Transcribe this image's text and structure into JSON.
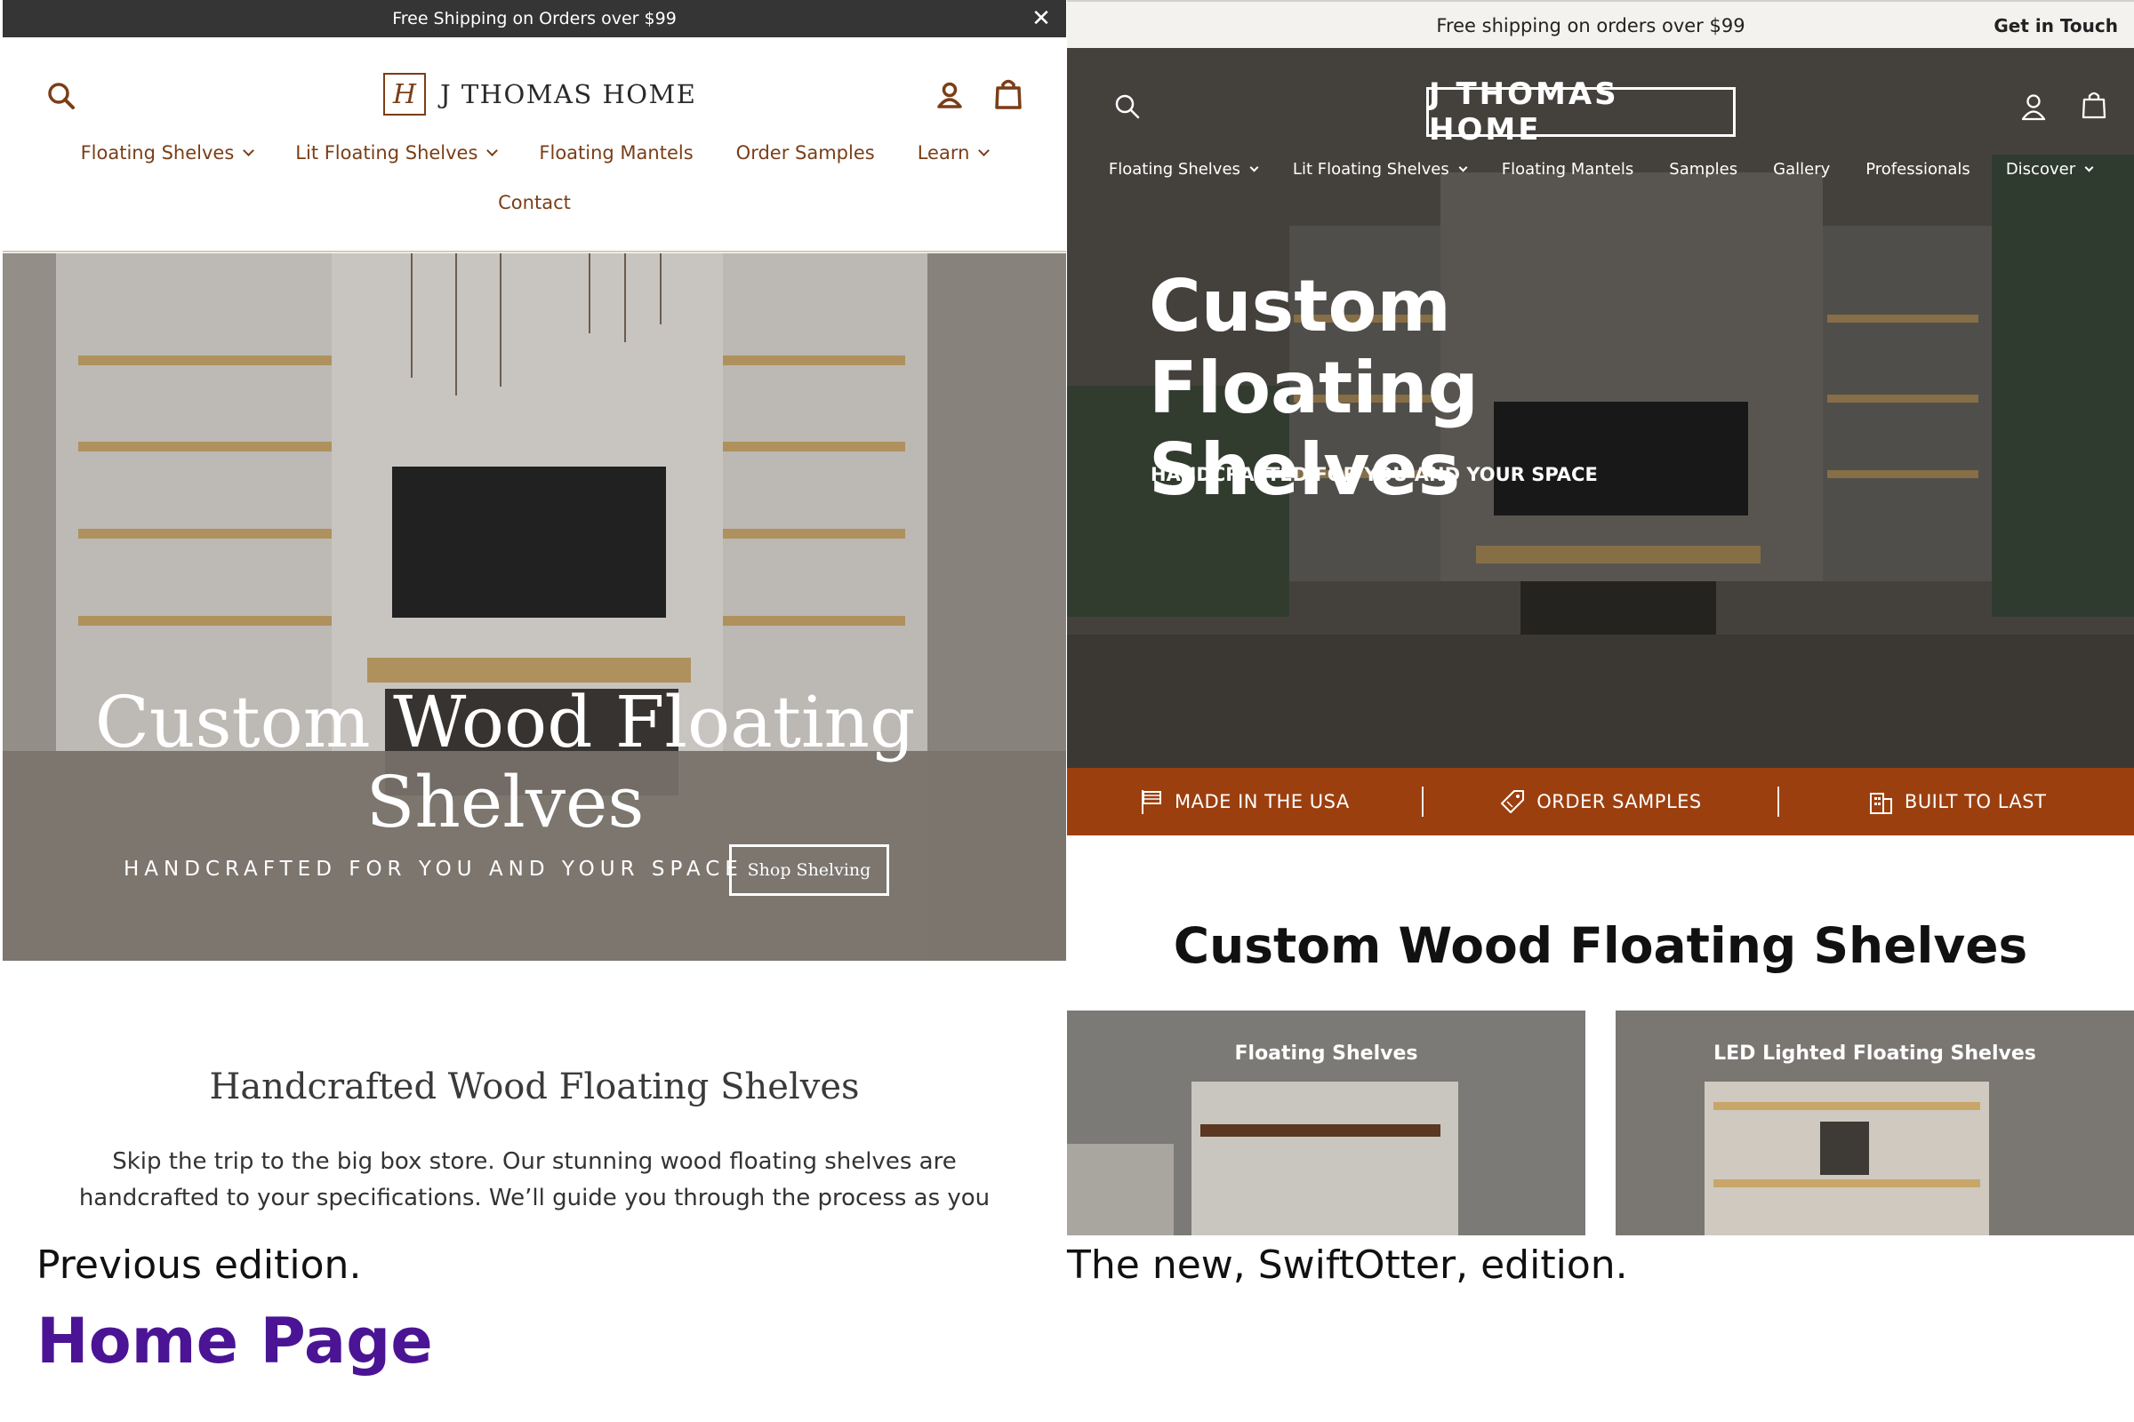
{
  "previous": {
    "announcement": "Free Shipping on Orders over $99",
    "close_label": "✕",
    "logo_mark": "H",
    "logo_text": "J THOMAS HOME",
    "nav": [
      {
        "label": "Floating Shelves",
        "has_dropdown": true
      },
      {
        "label": "Lit Floating Shelves",
        "has_dropdown": true
      },
      {
        "label": "Floating Mantels",
        "has_dropdown": false
      },
      {
        "label": "Order Samples",
        "has_dropdown": false
      },
      {
        "label": "Learn",
        "has_dropdown": true
      }
    ],
    "contact_label": "Contact",
    "hero_title": "Custom Wood Floating Shelves",
    "hero_subtitle": "HANDCRAFTED FOR YOU AND YOUR SPACE",
    "hero_button": "Shop Shelving",
    "section_title": "Handcrafted Wood Floating Shelves",
    "section_text": "Skip the trip to the big box store. Our stunning wood floating shelves are handcrafted to your specifications. We’ll guide you through the process as you",
    "accent_color": "#7a3e17",
    "icons": [
      "search-icon",
      "account-icon",
      "cart-icon",
      "close-icon",
      "chevron-down-icon"
    ]
  },
  "new": {
    "announcement": "Free shipping on orders over $99",
    "get_in_touch": "Get in Touch",
    "logo_text": "J THOMAS HOME",
    "nav": [
      {
        "label": "Floating Shelves",
        "has_dropdown": true
      },
      {
        "label": "Lit Floating Shelves",
        "has_dropdown": true
      },
      {
        "label": "Floating Mantels",
        "has_dropdown": false
      },
      {
        "label": "Samples",
        "has_dropdown": false
      },
      {
        "label": "Gallery",
        "has_dropdown": false
      },
      {
        "label": "Professionals",
        "has_dropdown": false
      },
      {
        "label": "Discover",
        "has_dropdown": true
      }
    ],
    "hero_title": "Custom Floating Shelves",
    "hero_subtitle": "HANDCRAFTED FOR YOU AND YOUR SPACE",
    "benefits": [
      {
        "label": "MADE IN THE USA",
        "icon": "flag-icon"
      },
      {
        "label": "ORDER SAMPLES",
        "icon": "tag-icon"
      },
      {
        "label": "BUILT TO LAST",
        "icon": "building-icon"
      }
    ],
    "section_title": "Custom Wood Floating Shelves",
    "cards": [
      {
        "title": "Floating Shelves"
      },
      {
        "title": "LED Lighted Floating Shelves"
      }
    ],
    "accent_color": "#9c3f0f"
  },
  "captions": {
    "left": "Previous edition.",
    "right": "The new, SwiftOtter, edition.",
    "page_label": "Home Page",
    "page_label_color": "#4a1495"
  }
}
